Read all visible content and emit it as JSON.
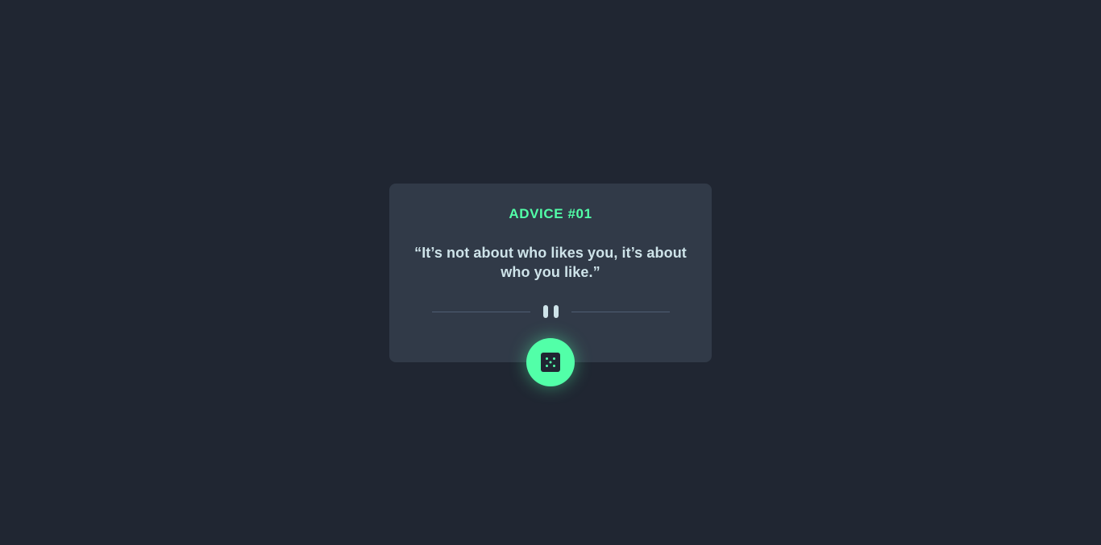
{
  "advice": {
    "id_label": "ADVICE #01",
    "quote": "“It’s not about who likes you, it’s about who you like.”"
  },
  "divider": {
    "icon": "pause-icon"
  },
  "button": {
    "icon": "dice-icon",
    "accent_color": "#52ffa8"
  },
  "colors": {
    "background": "#202632",
    "card": "#313a48",
    "text": "#cee3e9",
    "accent": "#52ffa8"
  }
}
